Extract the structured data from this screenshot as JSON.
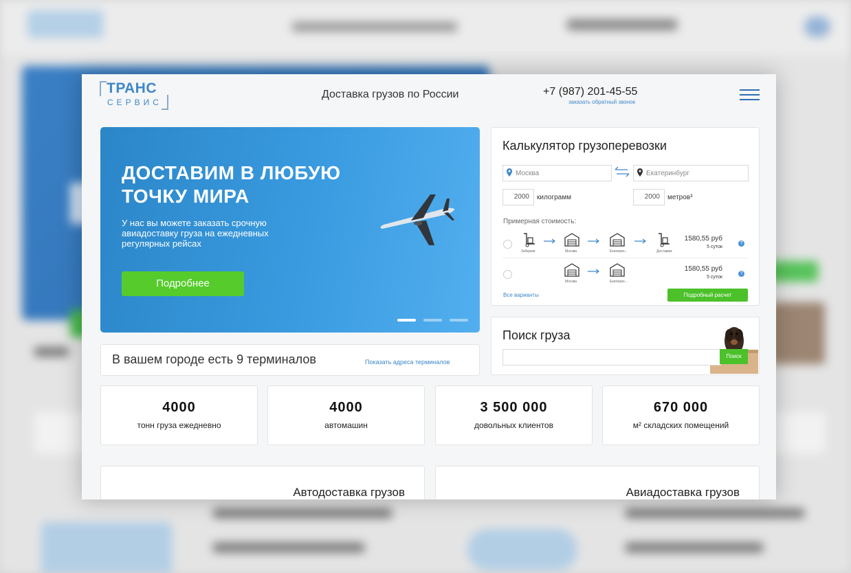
{
  "header": {
    "logo_top": "ТРАНС",
    "logo_bottom": "СЕРВИС",
    "tagline": "Доставка грузов по России",
    "phone": "+7 (987) 201-45-55",
    "callback": "заказать обратный звонок",
    "menu_icon": "hamburger-icon"
  },
  "hero": {
    "title": "ДОСТАВИМ В ЛЮБУЮ ТОЧКУ МИРА",
    "subtitle": "У нас вы можете заказать срочную авиадоставку груза на ежедневных регулярных рейсах",
    "button": "Подробнее",
    "slides": 3,
    "active_slide": 1
  },
  "terminals": {
    "title": "В вашем городе есть 9 терминалов",
    "link": "Показать адреса терминалов"
  },
  "calculator": {
    "title": "Калькулятор грузоперевозки",
    "from": "Москва",
    "to": "Екатеринбург",
    "weight": "2000",
    "weight_unit": "килограмм",
    "volume": "2000",
    "volume_unit": "метров³",
    "approx_label": "Примерная стоимость:",
    "routes": [
      {
        "steps": [
          "Заберем",
          "Москва",
          "Екатерин...",
          "Доставим"
        ],
        "price": "1580,55 руб",
        "days": "5 суток"
      },
      {
        "steps": [
          "Москва",
          "Екатерин..."
        ],
        "price": "1580,55 руб",
        "days": "5 суток"
      }
    ],
    "help_glyph": "?",
    "all_variants": "Все варианты",
    "detail_button": "Подробный расчет"
  },
  "search": {
    "title": "Поиск груза",
    "input_value": "",
    "button": "Поиск"
  },
  "stats": [
    {
      "number": "4000",
      "label": "тонн груза ежедневно"
    },
    {
      "number": "4000",
      "label": "автомашин"
    },
    {
      "number": "3 500 000",
      "label": "довольных клиентов"
    },
    {
      "number": "670 000",
      "label": "м² складских помещений"
    }
  ],
  "services": [
    {
      "title": "Автодоставка грузов"
    },
    {
      "title": "Авиадоставка грузов"
    }
  ],
  "colors": {
    "brand_blue": "#3e88c9",
    "accent_green": "#4cc12a"
  }
}
